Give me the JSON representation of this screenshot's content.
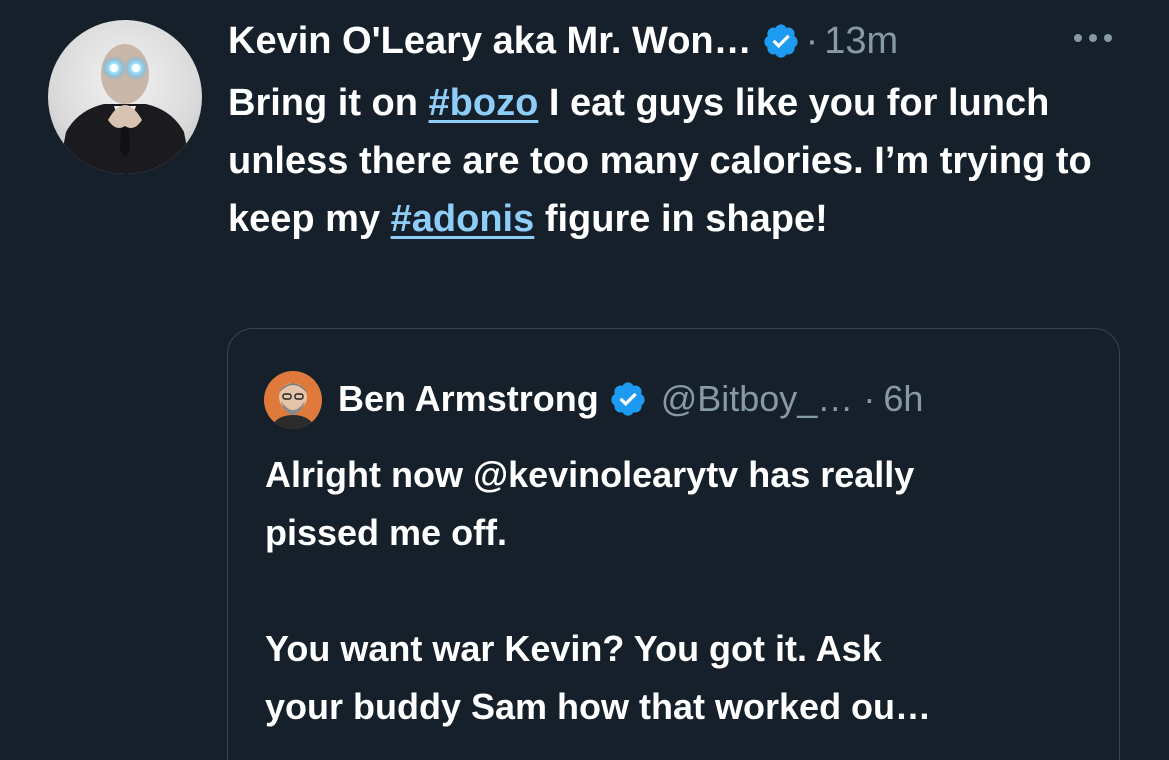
{
  "tweet": {
    "author": {
      "name": "Kevin O'Leary aka Mr. Won…"
    },
    "separator": "·",
    "time": "13m",
    "text": {
      "part1": "Bring it on ",
      "hashtag1": "#bozo",
      "part2": " I eat guys like you for lunch unless there are too many calories. I’m trying to keep my ",
      "hashtag2": "#adonis",
      "part3": " figure in shape!"
    }
  },
  "quoted_tweet": {
    "author": {
      "name": "Ben Armstrong",
      "handle": "@Bitboy_…"
    },
    "separator": "·",
    "time": "6h",
    "text_lines": [
      "Alright now @kevinolearytv has really",
      "pissed me off.",
      "",
      "You want war Kevin? You got it. Ask",
      "your buddy Sam how that worked ou…"
    ]
  },
  "colors": {
    "background": "#15202b",
    "text": "#ffffff",
    "muted": "#8899a6",
    "link": "#8ecdf8",
    "verified": "#1d9bf0",
    "card_border": "#38444d"
  },
  "icons": {
    "verified": "verified-badge-icon",
    "more": "more-options-icon"
  }
}
